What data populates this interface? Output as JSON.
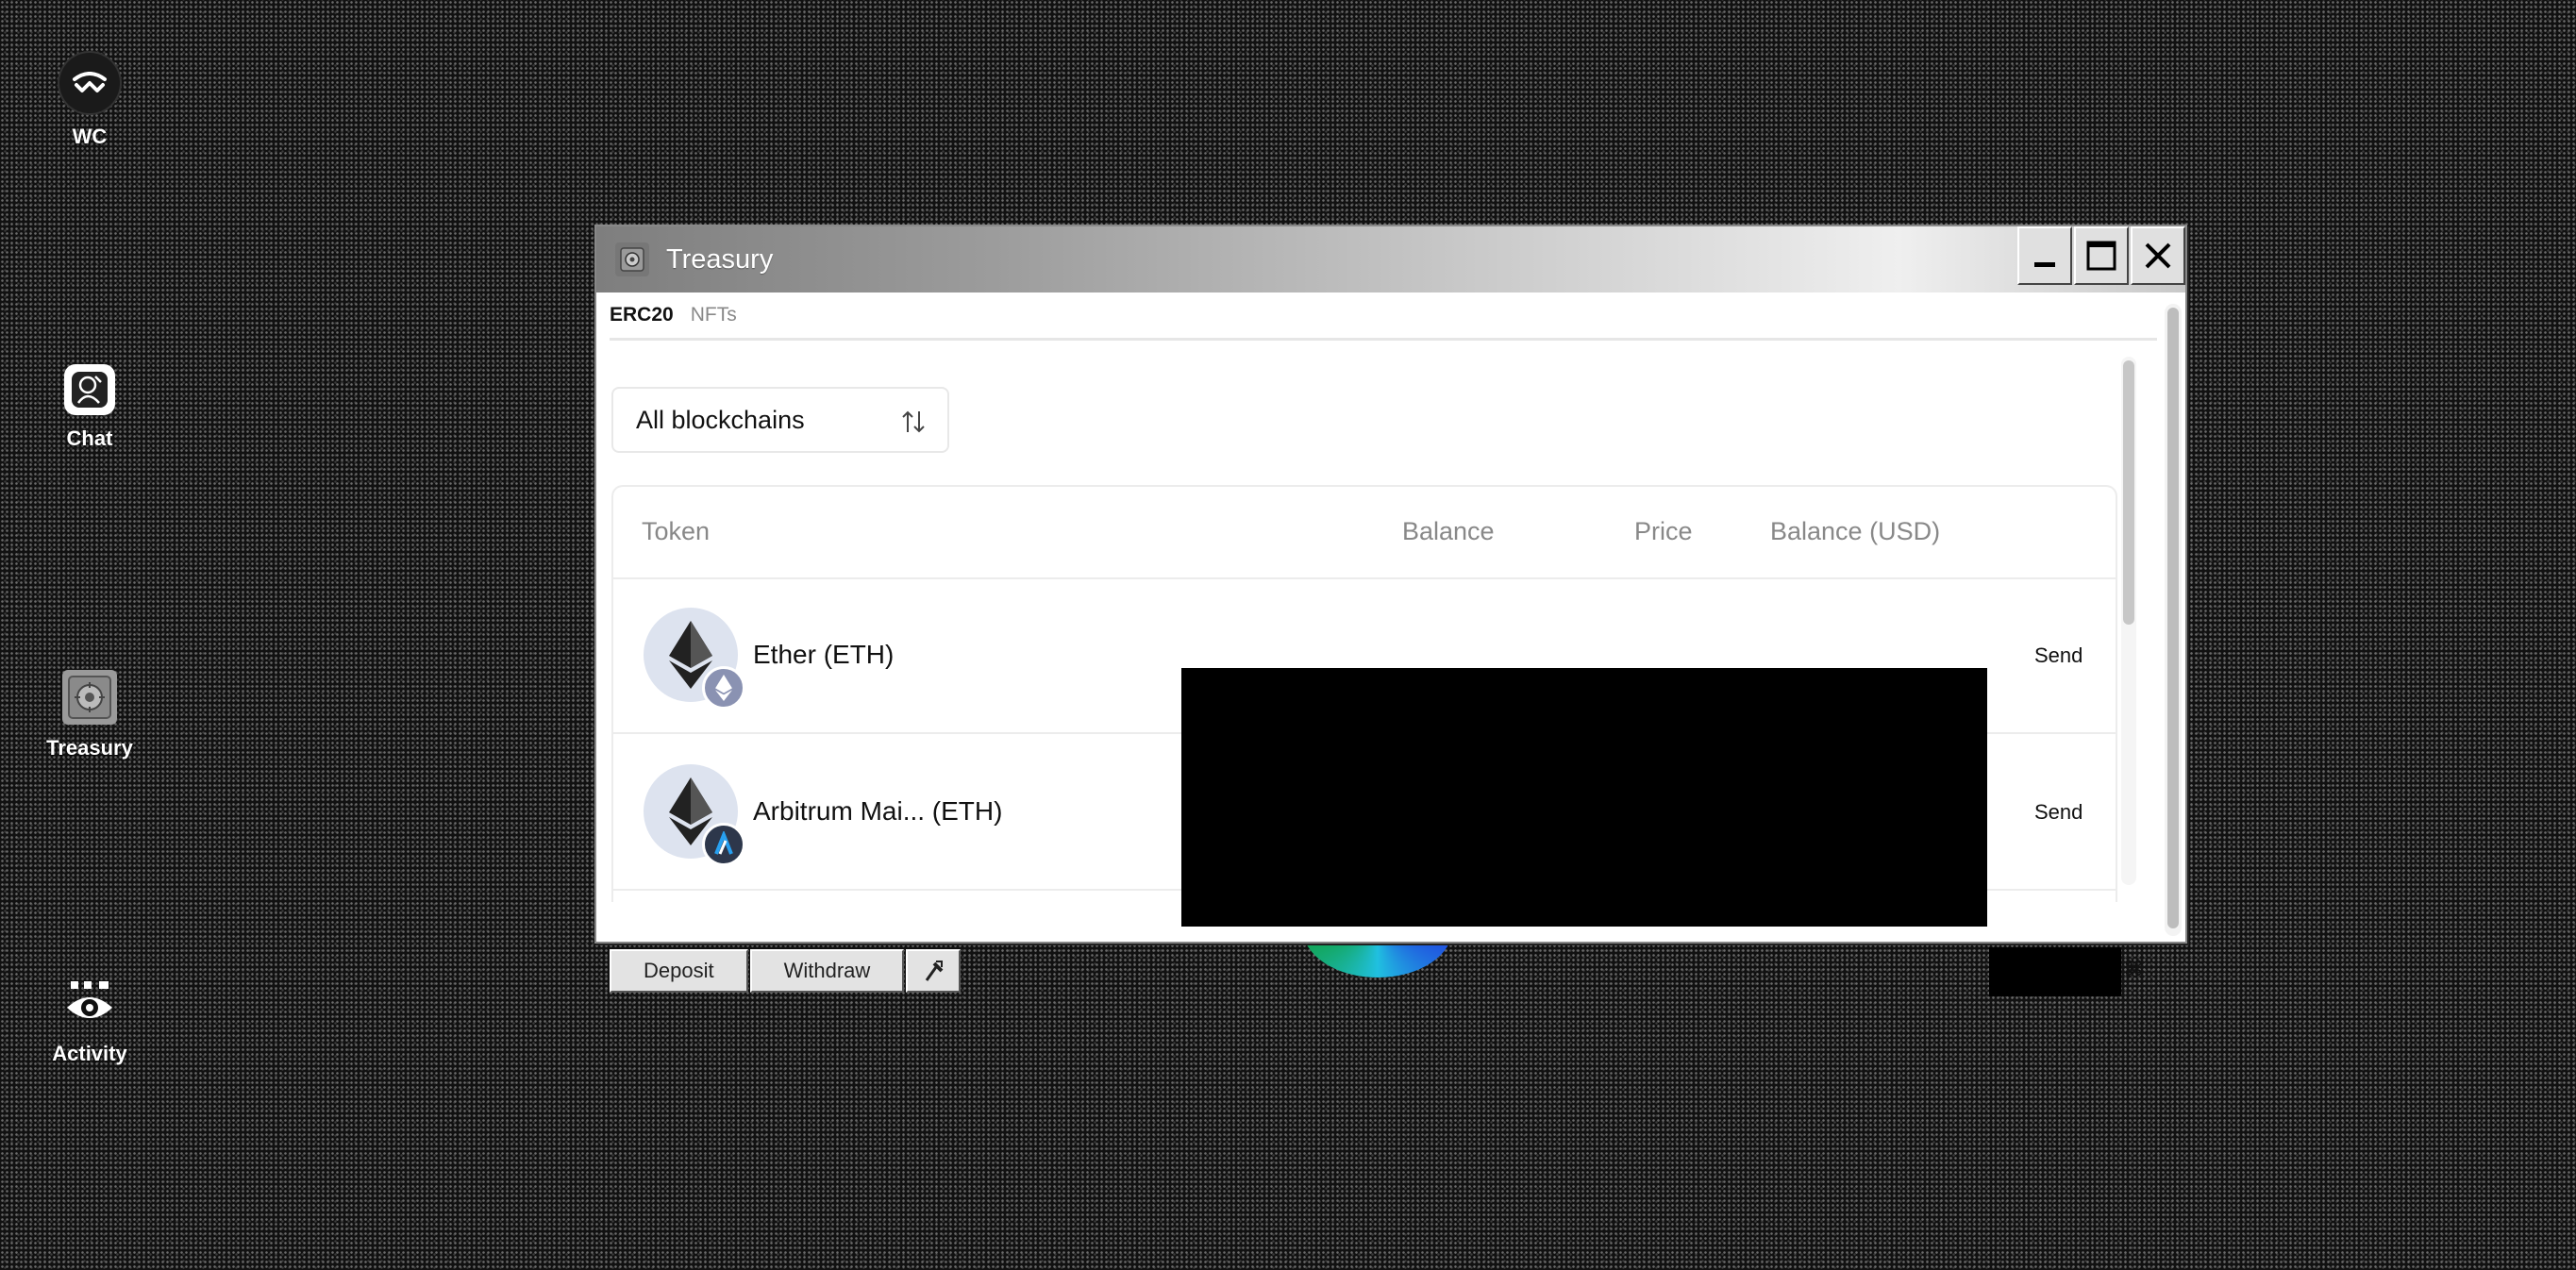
{
  "desktop": {
    "icons": [
      {
        "label": "WC",
        "icon": "walletconnect-icon"
      },
      {
        "label": "Chat",
        "icon": "chat-icon"
      },
      {
        "label": "Treasury",
        "icon": "treasury-icon"
      },
      {
        "label": "Activity",
        "icon": "eye-icon"
      }
    ]
  },
  "window": {
    "title": "Treasury",
    "controls": [
      "minimize",
      "maximize",
      "close"
    ]
  },
  "tabs": [
    {
      "label": "ERC20",
      "active": true
    },
    {
      "label": "NFTs",
      "active": false
    }
  ],
  "filter": {
    "selected": "All blockchains"
  },
  "table": {
    "columns": [
      "Token",
      "Balance",
      "Price",
      "Balance (USD)"
    ],
    "rows": [
      {
        "name": "Ether (ETH)",
        "chain_badge": "ethereum-icon",
        "action": "Send"
      },
      {
        "name": "Arbitrum Mai...   (ETH)",
        "chain_badge": "arbitrum-icon",
        "action": "Send"
      }
    ]
  },
  "bottom_bar": {
    "deposit": "Deposit",
    "withdraw": "Withdraw",
    "tool_icon": "pipette-icon",
    "shortcut_glyph": "⌘"
  },
  "colors": {
    "title_gradient_start": "#7e7e7e",
    "title_gradient_end": "#efefef",
    "token_icon_bg": "#dde3ef",
    "arbitrum_badge": "#2d374b",
    "ethereum_badge": "#8a92b2"
  }
}
